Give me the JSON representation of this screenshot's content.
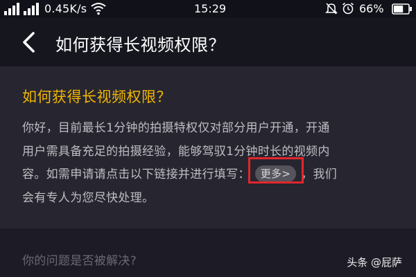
{
  "status_bar": {
    "signal_icon": "cellular-signal-icon",
    "network_speed": "0.45K/s",
    "wifi_icon": "wifi-icon",
    "time": "15:29",
    "mute_icon": "bell-mute-icon",
    "alarm_icon": "alarm-clock-icon",
    "battery_percent": "66%",
    "battery_level": 0.66
  },
  "header": {
    "back_icon": "chevron-left-icon",
    "title": "如何获得长视频权限？"
  },
  "article": {
    "question_title": "如何获得长视频权限？",
    "answer_line_1": "你好，目前最长1分钟的拍摄特权仅对部分用户开通，开通",
    "answer_line_2": "用户需具备充足的拍摄经验，能够驾驭1分钟时长的视频内",
    "answer_line_3a": "容。如需申请请点击以下链接并进行填写：",
    "more_link": "更多>",
    "answer_line_3b": "，我们",
    "answer_line_4": "会有专人为您尽快处理。"
  },
  "feedback": {
    "prompt": "你的问题是否被解决?"
  },
  "watermark": {
    "text": "头条 @屁萨"
  },
  "colors": {
    "background": "#1d1c26",
    "card": "#272630",
    "question_accent": "#f2b600",
    "highlight_box": "#e3262c"
  }
}
